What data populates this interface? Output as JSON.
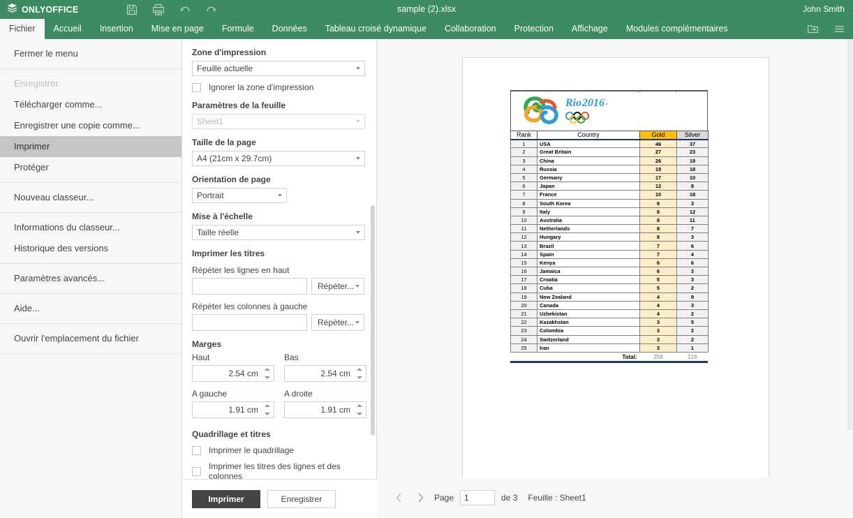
{
  "titlebar": {
    "brand": "ONLYOFFICE",
    "brand_icon": "layers-logo-icon",
    "doc_title": "sample (2).xlsx",
    "user": "John Smith",
    "icons": [
      {
        "name": "save-icon",
        "label": "Enregistrer"
      },
      {
        "name": "print-icon",
        "label": "Imprimer"
      },
      {
        "name": "undo-icon",
        "label": "Annuler"
      },
      {
        "name": "redo-icon",
        "label": "Rétablir"
      }
    ]
  },
  "tabs": [
    {
      "id": "fichier",
      "label": "Fichier",
      "active": true
    },
    {
      "id": "accueil",
      "label": "Accueil",
      "active": false
    },
    {
      "id": "insertion",
      "label": "Insertion",
      "active": false
    },
    {
      "id": "mise-en-page",
      "label": "Mise en page",
      "active": false
    },
    {
      "id": "formule",
      "label": "Formule",
      "active": false
    },
    {
      "id": "donnees",
      "label": "Données",
      "active": false
    },
    {
      "id": "tcd",
      "label": "Tableau croisé dynamique",
      "active": false
    },
    {
      "id": "collaboration",
      "label": "Collaboration",
      "active": false
    },
    {
      "id": "protection",
      "label": "Protection",
      "active": false
    },
    {
      "id": "affichage",
      "label": "Affichage",
      "active": false
    },
    {
      "id": "modules",
      "label": "Modules complémentaires",
      "active": false
    }
  ],
  "tabbar_right_icons": [
    {
      "name": "open-file-location-icon"
    },
    {
      "name": "hamburger-menu-icon"
    }
  ],
  "filemenu": {
    "groups": [
      {
        "items": [
          {
            "id": "fermer",
            "label": "Fermer le menu",
            "state": "normal"
          }
        ]
      },
      {
        "items": [
          {
            "id": "enregistrer",
            "label": "Enregistrer",
            "state": "disabled"
          },
          {
            "id": "telecharger",
            "label": "Télécharger comme...",
            "state": "normal"
          },
          {
            "id": "copie",
            "label": "Enregistrer une copie comme...",
            "state": "normal"
          },
          {
            "id": "imprimer",
            "label": "Imprimer",
            "state": "active"
          },
          {
            "id": "proteger",
            "label": "Protéger",
            "state": "normal"
          }
        ]
      },
      {
        "items": [
          {
            "id": "nouveau",
            "label": "Nouveau classeur...",
            "state": "normal"
          }
        ]
      },
      {
        "items": [
          {
            "id": "infos",
            "label": "Informations du classeur...",
            "state": "normal"
          },
          {
            "id": "historique",
            "label": "Historique des versions",
            "state": "normal"
          }
        ]
      },
      {
        "items": [
          {
            "id": "avances",
            "label": "Paramètres avancés...",
            "state": "normal"
          }
        ]
      },
      {
        "items": [
          {
            "id": "aide",
            "label": "Aide...",
            "state": "normal"
          }
        ]
      },
      {
        "items": [
          {
            "id": "emplacement",
            "label": "Ouvrir l'emplacement du fichier",
            "state": "normal"
          }
        ]
      }
    ]
  },
  "settings": {
    "print_range_label": "Zone d'impression",
    "print_range_value": "Feuille actuelle",
    "ignore_print_area_label": "Ignorer la zone d'impression",
    "ignore_print_area_checked": false,
    "sheet_settings_label": "Paramètres de la feuille",
    "sheet_settings_value": "Sheet1",
    "page_size_label": "Taille de la page",
    "page_size_value": "A4 (21cm x 29.7cm)",
    "orientation_label": "Orientation de page",
    "orientation_value": "Portrait",
    "scaling_label": "Mise à l'échelle",
    "scaling_value": "Taille réelle",
    "print_titles_label": "Imprimer les titres",
    "repeat_rows_label": "Répéter les lignes en haut",
    "repeat_rows_value": "",
    "repeat_rows_button": "Répéter...",
    "repeat_cols_label": "Répéter les colonnes à gauche",
    "repeat_cols_value": "",
    "repeat_cols_button": "Répéter...",
    "margins_label": "Marges",
    "margin_top_label": "Haut",
    "margin_top_value": "2.54 cm",
    "margin_bottom_label": "Bas",
    "margin_bottom_value": "2.54 cm",
    "margin_left_label": "A gauche",
    "margin_left_value": "1.91 cm",
    "margin_right_label": "A droite",
    "margin_right_value": "1.91 cm",
    "gridlines_label": "Quadrillage et titres",
    "print_gridlines_label": "Imprimer le quadrillage",
    "print_gridlines_checked": false,
    "print_headings_label": "Imprimer les titres des lignes et des colonnes",
    "print_headings_checked": false,
    "print_button": "Imprimer",
    "save_button": "Enregistrer"
  },
  "pager": {
    "prev_icon": "chevron-left-icon",
    "next_icon": "chevron-right-icon",
    "page_label": "Page",
    "page_value": "1",
    "of_label": "de 3",
    "sheet_label": "Feuille : Sheet1"
  },
  "preview_sheet": {
    "logo_alt": "Rio2016 Olympic logo",
    "logo_text": "Rio2016",
    "headers": [
      "Rank",
      "Country",
      "Gold",
      "Silver"
    ],
    "colors": {
      "gold_header": "#ffc000",
      "silver_header": "#d9d9d9",
      "gold_cell": "#fdeeca",
      "rank_cell": "#f2f2f2",
      "accent_rule": "#1f3864"
    },
    "rows": [
      {
        "rank": "1",
        "country": "USA",
        "gold": "46",
        "silver": "37"
      },
      {
        "rank": "2",
        "country": "Great Britain",
        "gold": "27",
        "silver": "23"
      },
      {
        "rank": "3",
        "country": "China",
        "gold": "26",
        "silver": "18"
      },
      {
        "rank": "4",
        "country": "Russia",
        "gold": "19",
        "silver": "18"
      },
      {
        "rank": "5",
        "country": "Germany",
        "gold": "17",
        "silver": "10"
      },
      {
        "rank": "6",
        "country": "Japan",
        "gold": "12",
        "silver": "8"
      },
      {
        "rank": "7",
        "country": "France",
        "gold": "10",
        "silver": "18"
      },
      {
        "rank": "8",
        "country": "South Korea",
        "gold": "9",
        "silver": "3"
      },
      {
        "rank": "9",
        "country": "Italy",
        "gold": "8",
        "silver": "12"
      },
      {
        "rank": "10",
        "country": "Australia",
        "gold": "8",
        "silver": "11"
      },
      {
        "rank": "11",
        "country": "Netherlands",
        "gold": "8",
        "silver": "7"
      },
      {
        "rank": "12",
        "country": "Hungary",
        "gold": "8",
        "silver": "3"
      },
      {
        "rank": "13",
        "country": "Brazil",
        "gold": "7",
        "silver": "6"
      },
      {
        "rank": "14",
        "country": "Spain",
        "gold": "7",
        "silver": "4"
      },
      {
        "rank": "15",
        "country": "Kenya",
        "gold": "6",
        "silver": "6"
      },
      {
        "rank": "16",
        "country": "Jamaica",
        "gold": "6",
        "silver": "3"
      },
      {
        "rank": "17",
        "country": "Croatia",
        "gold": "5",
        "silver": "3"
      },
      {
        "rank": "18",
        "country": "Cuba",
        "gold": "5",
        "silver": "2"
      },
      {
        "rank": "19",
        "country": "New Zealand",
        "gold": "4",
        "silver": "9"
      },
      {
        "rank": "20",
        "country": "Canada",
        "gold": "4",
        "silver": "3"
      },
      {
        "rank": "21",
        "country": "Uzbekistan",
        "gold": "4",
        "silver": "2"
      },
      {
        "rank": "22",
        "country": "Kazakhstan",
        "gold": "3",
        "silver": "5"
      },
      {
        "rank": "23",
        "country": "Colombia",
        "gold": "3",
        "silver": "2"
      },
      {
        "rank": "24",
        "country": "Switzerland",
        "gold": "3",
        "silver": "2"
      },
      {
        "rank": "25",
        "country": "Iran",
        "gold": "3",
        "silver": "1"
      }
    ],
    "total_label": "Total:",
    "total_gold": "258",
    "total_silver": "216"
  }
}
